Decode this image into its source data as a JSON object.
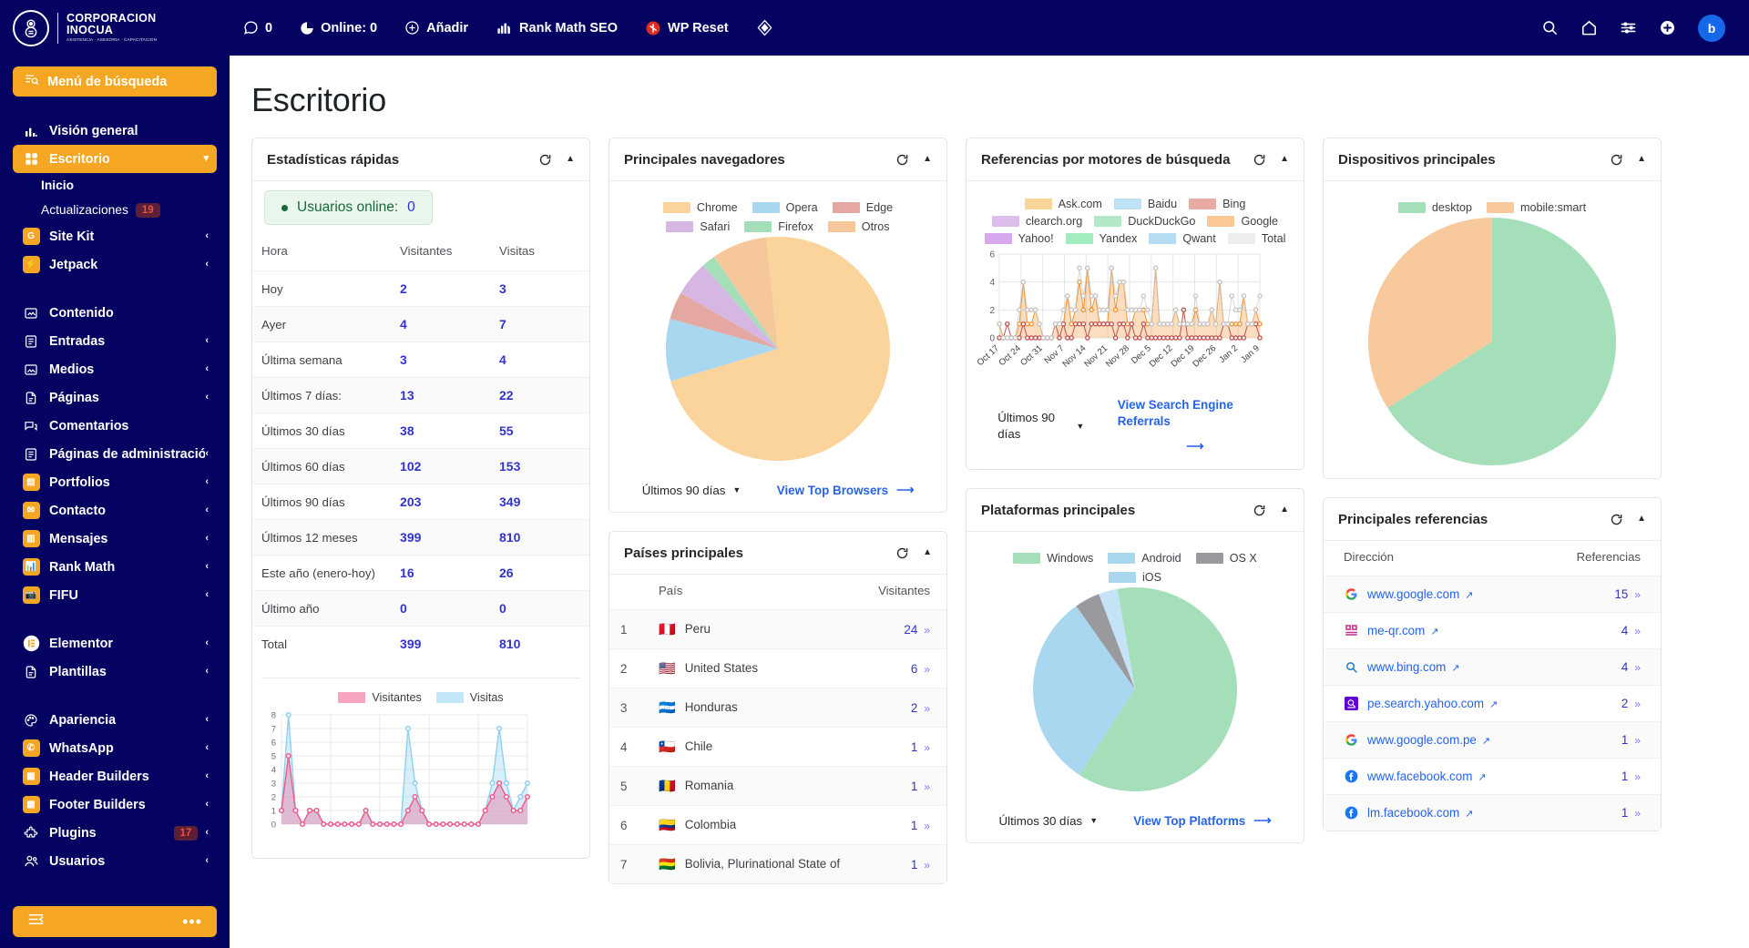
{
  "brand": {
    "line1": "CORPORACION",
    "line2": "INOCUA",
    "line3": "ASISTENCIA · ASESORIA · CAPACITACION"
  },
  "adminbar": {
    "items": [
      {
        "icon": "comment-icon",
        "label": "0",
        "name": "comments-count"
      },
      {
        "icon": "pie-icon",
        "label": "Online: 0",
        "name": "online-count"
      },
      {
        "icon": "plus-circle-icon",
        "label": "Añadir",
        "name": "add-new"
      },
      {
        "icon": "rank-math-icon",
        "label": "Rank Math SEO",
        "name": "rank-math-seo"
      },
      {
        "icon": "wp-reset-icon",
        "label": "WP Reset",
        "name": "wp-reset"
      },
      {
        "icon": "diamond-icon",
        "label": "",
        "name": "diamond"
      }
    ],
    "right_icons": [
      "search-icon",
      "home-icon",
      "sliders-icon",
      "plus-icon"
    ],
    "avatar_letter": "b"
  },
  "sidebar": {
    "search_label": "Menú de búsqueda",
    "groups": [
      {
        "items": [
          {
            "label": "Visión general",
            "icon": "bar-chart-icon",
            "name": "vision-general",
            "active": false,
            "chev": false
          },
          {
            "label": "Escritorio",
            "icon": "grid-icon",
            "name": "escritorio",
            "active": true,
            "chev": true
          }
        ]
      },
      {
        "subitems": [
          {
            "label": "Inicio",
            "name": "inicio",
            "current": true
          },
          {
            "label": "Actualizaciones",
            "name": "actualizaciones",
            "badge": "19"
          }
        ]
      },
      {
        "items": [
          {
            "label": "Site Kit",
            "icon": "sitekit-icon",
            "name": "site-kit",
            "chev": true,
            "square": true
          },
          {
            "label": "Jetpack",
            "icon": "jetpack-icon",
            "name": "jetpack",
            "chev": true,
            "square": true
          }
        ]
      },
      {
        "items": [
          {
            "label": "Contenido",
            "icon": "content-icon",
            "name": "contenido",
            "chev": false
          },
          {
            "label": "Entradas",
            "icon": "posts-icon",
            "name": "entradas",
            "chev": true
          },
          {
            "label": "Medios",
            "icon": "media-icon",
            "name": "medios",
            "chev": true
          },
          {
            "label": "Páginas",
            "icon": "pages-icon",
            "name": "paginas",
            "chev": true
          },
          {
            "label": "Comentarios",
            "icon": "comments-icon",
            "name": "comentarios",
            "chev": false
          },
          {
            "label": "Páginas de administración",
            "icon": "admin-pages-icon",
            "name": "paginas-administracion",
            "chev": true
          },
          {
            "label": "Portfolios",
            "icon": "portfolio-icon",
            "name": "portfolios",
            "chev": true,
            "square": true
          },
          {
            "label": "Contacto",
            "icon": "mail-icon",
            "name": "contacto",
            "chev": true,
            "square": true
          },
          {
            "label": "Mensajes",
            "icon": "messages-icon",
            "name": "mensajes",
            "chev": true,
            "square": true
          },
          {
            "label": "Rank Math",
            "icon": "rank-math-icon",
            "name": "rank-math",
            "chev": true,
            "square": true
          },
          {
            "label": "FIFU",
            "icon": "camera-icon",
            "name": "fifu",
            "chev": true,
            "square": true
          }
        ]
      },
      {
        "items": [
          {
            "label": "Elementor",
            "icon": "elementor-icon",
            "name": "elementor",
            "chev": true,
            "square": true
          },
          {
            "label": "Plantillas",
            "icon": "template-icon",
            "name": "plantillas",
            "chev": true
          }
        ]
      },
      {
        "items": [
          {
            "label": "Apariencia",
            "icon": "palette-icon",
            "name": "apariencia",
            "chev": true
          },
          {
            "label": "WhatsApp",
            "icon": "whatsapp-icon",
            "name": "whatsapp",
            "chev": true,
            "square": true
          },
          {
            "label": "Header Builders",
            "icon": "header-icon",
            "name": "header-builders",
            "chev": true,
            "square": true
          },
          {
            "label": "Footer Builders",
            "icon": "footer-icon",
            "name": "footer-builders",
            "chev": true,
            "square": true
          },
          {
            "label": "Plugins",
            "icon": "plugin-icon",
            "name": "plugins",
            "chev": true,
            "badge": "17"
          },
          {
            "label": "Usuarios",
            "icon": "users-icon",
            "name": "usuarios",
            "chev": true
          }
        ]
      }
    ],
    "collapse_dots": "•••"
  },
  "page": {
    "title": "Escritorio"
  },
  "quick_stats": {
    "title": "Estadísticas rápidas",
    "online_label": "Usuarios online:",
    "online_value": "0",
    "columns": [
      "Hora",
      "Visitantes",
      "Visitas"
    ],
    "rows": [
      {
        "label": "Hoy",
        "visitors": "2",
        "visits": "3"
      },
      {
        "label": "Ayer",
        "visitors": "4",
        "visits": "7"
      },
      {
        "label": "Última semana",
        "visitors": "3",
        "visits": "4"
      },
      {
        "label": "Últimos 7 días:",
        "visitors": "13",
        "visits": "22"
      },
      {
        "label": "Últimos 30 días",
        "visitors": "38",
        "visits": "55"
      },
      {
        "label": "Últimos 60 días",
        "visitors": "102",
        "visits": "153"
      },
      {
        "label": "Últimos 90 días",
        "visitors": "203",
        "visits": "349"
      },
      {
        "label": "Últimos 12 meses",
        "visitors": "399",
        "visits": "810"
      },
      {
        "label": "Este año (enero-hoy)",
        "visitors": "16",
        "visits": "26"
      },
      {
        "label": "Último año",
        "visitors": "0",
        "visits": "0"
      },
      {
        "label": "Total",
        "visitors": "399",
        "visits": "810"
      }
    ],
    "mini_chart": {
      "type": "area",
      "legend": [
        "Visitantes",
        "Visitas"
      ],
      "ylabels": [
        "8",
        "7",
        "6",
        "5",
        "4",
        "3",
        "2",
        "1",
        "0"
      ],
      "ylim": [
        0,
        8
      ],
      "series": [
        {
          "name": "Visitantes",
          "color": "#ef5a8c",
          "values": [
            1,
            5,
            1,
            0,
            1,
            1,
            0,
            0,
            0,
            0,
            0,
            0,
            1,
            0,
            0,
            0,
            0,
            0,
            1,
            2,
            1,
            0,
            0,
            0,
            0,
            0,
            0,
            0,
            0,
            1,
            2,
            3,
            2,
            1,
            1,
            2
          ]
        },
        {
          "name": "Visitas",
          "color": "#8fd0f0",
          "values": [
            1,
            8,
            1,
            0,
            1,
            1,
            0,
            0,
            0,
            0,
            0,
            0,
            1,
            0,
            0,
            0,
            0,
            0,
            7,
            3,
            1,
            0,
            0,
            0,
            0,
            0,
            0,
            0,
            0,
            1,
            3,
            7,
            3,
            1,
            2,
            3
          ]
        }
      ]
    }
  },
  "browsers": {
    "title": "Principales navegadores",
    "legend": [
      {
        "label": "Chrome",
        "color": "#fad49b"
      },
      {
        "label": "Opera",
        "color": "#a9d7f0"
      },
      {
        "label": "Edge",
        "color": "#e4a7a2"
      },
      {
        "label": "Safari",
        "color": "#d6b6e3"
      },
      {
        "label": "Firefox",
        "color": "#a5dfba"
      },
      {
        "label": "Otros",
        "color": "#f5c79a"
      }
    ],
    "chart_data": {
      "type": "pie",
      "title": "Principales navegadores",
      "labels": [
        "Chrome",
        "Opera",
        "Edge",
        "Safari",
        "Firefox",
        "Otros"
      ],
      "values": [
        72,
        9,
        4,
        5,
        2,
        8
      ],
      "colors": [
        "#fad49b",
        "#a9d7f0",
        "#e4a7a2",
        "#d6b6e3",
        "#a5dfba",
        "#f5c79a"
      ],
      "legend_position": "top"
    },
    "range": "Últimos 90 días",
    "link": "View Top Browsers"
  },
  "search_engines": {
    "title": "Referencias por motores de búsqueda",
    "legend": [
      {
        "label": "Ask.com",
        "color": "#fad49b"
      },
      {
        "label": "Baidu",
        "color": "#bfe0f5"
      },
      {
        "label": "Bing",
        "color": "#e8a9a4"
      },
      {
        "label": "clearch.org",
        "color": "#ddbdec"
      },
      {
        "label": "DuckDuckGo",
        "color": "#b2e8c6"
      },
      {
        "label": "Google",
        "color": "#fac895"
      },
      {
        "label": "Yahoo!",
        "color": "#d8a8ee"
      },
      {
        "label": "Yandex",
        "color": "#a3ecc0"
      },
      {
        "label": "Qwant",
        "color": "#b4dcf2"
      },
      {
        "label": "Total",
        "color": "#ededed"
      }
    ],
    "chart_data": {
      "type": "line",
      "title": "Referencias por motores de búsqueda",
      "ylabels": [
        "0",
        "2",
        "4",
        "6"
      ],
      "ylim": [
        0,
        6
      ],
      "xlabels": [
        "Oct 17",
        "Oct 24",
        "Oct 31",
        "Nov 7",
        "Nov 14",
        "Nov 21",
        "Nov 28",
        "Dec 5",
        "Dec 12",
        "Dec 19",
        "Dec 26",
        "Jan 2",
        "Jan 9"
      ],
      "series": [
        {
          "name": "Google",
          "color": "#f2922e",
          "values": [
            1,
            0,
            0,
            0,
            0,
            1,
            4,
            1,
            1,
            2,
            1,
            0,
            0,
            0,
            1,
            1,
            1,
            3,
            1,
            2,
            4,
            2,
            5,
            2,
            3,
            1,
            1,
            1,
            5,
            2,
            4,
            4,
            1,
            1,
            2,
            2,
            2,
            1,
            1,
            5,
            1,
            1,
            1,
            1,
            2,
            1,
            1,
            1,
            1,
            2,
            1,
            1,
            1,
            2,
            1,
            4,
            1,
            1,
            1,
            1,
            1,
            3,
            1,
            1,
            2,
            1
          ]
        },
        {
          "name": "Bing",
          "color": "#c0504d",
          "values": [
            0,
            0,
            1,
            0,
            0,
            0,
            1,
            0,
            0,
            0,
            0,
            0,
            0,
            0,
            1,
            0,
            1,
            0,
            0,
            1,
            1,
            1,
            0,
            1,
            1,
            1,
            1,
            1,
            1,
            0,
            1,
            1,
            0,
            1,
            0,
            0,
            1,
            0,
            0,
            0,
            0,
            0,
            0,
            0,
            0,
            0,
            2,
            0,
            0,
            0,
            0,
            0,
            0,
            0,
            0,
            0,
            1,
            1,
            0,
            0,
            0,
            0,
            1,
            1,
            1,
            0
          ]
        },
        {
          "name": "Total",
          "color": "#c6c6c6",
          "values": [
            1,
            0,
            0,
            0,
            0,
            2,
            4,
            2,
            2,
            2,
            1,
            0,
            0,
            0,
            1,
            1,
            2,
            3,
            2,
            2,
            5,
            3,
            5,
            3,
            3,
            2,
            2,
            2,
            5,
            3,
            4,
            4,
            2,
            2,
            2,
            2,
            3,
            2,
            1,
            5,
            1,
            1,
            1,
            1,
            2,
            1,
            1,
            1,
            1,
            3,
            1,
            1,
            1,
            2,
            1,
            4,
            1,
            1,
            3,
            2,
            2,
            3,
            1,
            1,
            2,
            3
          ]
        }
      ],
      "grid": true
    },
    "range": "Últimos 90 días",
    "link": "View Search Engine Referrals"
  },
  "devices": {
    "title": "Dispositivos principales",
    "legend": [
      {
        "label": "desktop",
        "color": "#a5dfba"
      },
      {
        "label": "mobile:smart",
        "color": "#f7c99d"
      }
    ],
    "chart_data": {
      "type": "pie",
      "title": "Dispositivos principales",
      "labels": [
        "desktop",
        "mobile:smart"
      ],
      "values": [
        66,
        34
      ],
      "colors": [
        "#a5dfba",
        "#f7c99d"
      ],
      "legend_position": "top"
    }
  },
  "countries": {
    "title": "Países principales",
    "columns": [
      "País",
      "Visitantes"
    ],
    "rows": [
      {
        "idx": "1",
        "flag": "🇵🇪",
        "name": "Peru",
        "visitors": "24"
      },
      {
        "idx": "2",
        "flag": "🇺🇸",
        "name": "United States",
        "visitors": "6"
      },
      {
        "idx": "3",
        "flag": "🇭🇳",
        "name": "Honduras",
        "visitors": "2"
      },
      {
        "idx": "4",
        "flag": "🇨🇱",
        "name": "Chile",
        "visitors": "1"
      },
      {
        "idx": "5",
        "flag": "🇷🇴",
        "name": "Romania",
        "visitors": "1"
      },
      {
        "idx": "6",
        "flag": "🇨🇴",
        "name": "Colombia",
        "visitors": "1"
      },
      {
        "idx": "7",
        "flag": "🇧🇴",
        "name": "Bolivia, Plurinational State of",
        "visitors": "1"
      }
    ]
  },
  "platforms": {
    "title": "Plataformas principales",
    "legend": [
      {
        "label": "Windows",
        "color": "#a5dfba"
      },
      {
        "label": "Android",
        "color": "#a9d7f0"
      },
      {
        "label": "OS X",
        "color": "#9a9a9e"
      },
      {
        "label": "iOS",
        "color": "#a9d7f0"
      }
    ],
    "chart_data": {
      "type": "pie",
      "title": "Plataformas principales",
      "labels": [
        "Windows",
        "Android",
        "OS X",
        "iOS"
      ],
      "values": [
        62,
        31,
        4,
        3
      ],
      "colors": [
        "#a5dfba",
        "#a9d7f0",
        "#9a9a9e",
        "#c5e3f6"
      ],
      "legend_position": "top"
    },
    "range": "Últimos 30 días",
    "link": "View Top Platforms"
  },
  "referrers": {
    "title": "Principales referencias",
    "columns": [
      "Dirección",
      "Referencias"
    ],
    "rows": [
      {
        "icon": "google-icon",
        "address": "www.google.com",
        "count": "15"
      },
      {
        "icon": "qr-icon",
        "address": "me-qr.com",
        "count": "4"
      },
      {
        "icon": "bing-icon",
        "address": "www.bing.com",
        "count": "4"
      },
      {
        "icon": "yahoo-icon",
        "address": "pe.search.yahoo.com",
        "count": "2"
      },
      {
        "icon": "google-icon",
        "address": "www.google.com.pe",
        "count": "1"
      },
      {
        "icon": "facebook-icon",
        "address": "www.facebook.com",
        "count": "1"
      },
      {
        "icon": "facebook-icon",
        "address": "lm.facebook.com",
        "count": "1"
      }
    ]
  }
}
